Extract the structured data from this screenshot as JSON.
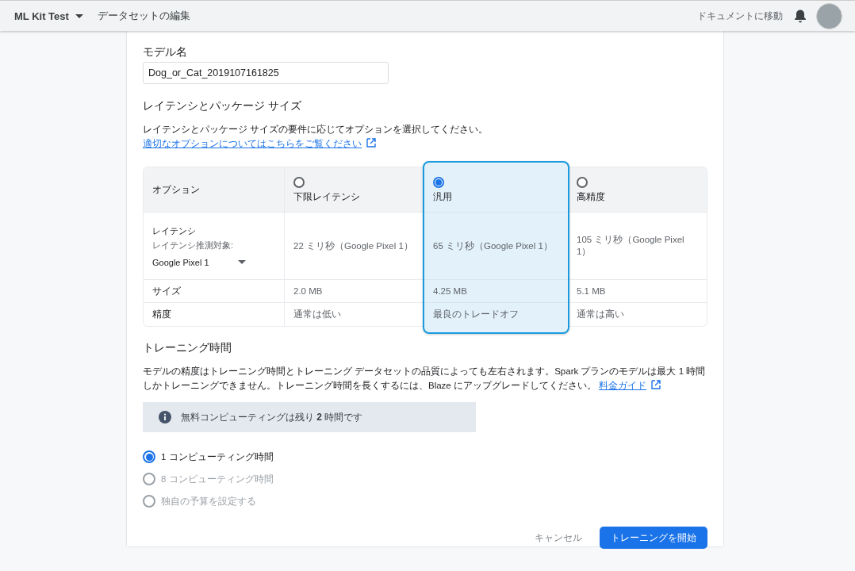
{
  "top_bar": {
    "project": "ML Kit Test",
    "page_title": "データセットの編集",
    "docs_link": "ドキュメントに移動"
  },
  "model_name": {
    "label": "モデル名",
    "value": "Dog_or_Cat_2019107161825"
  },
  "latency_section": {
    "heading": "レイテンシとパッケージ サイズ",
    "description": "レイテンシとパッケージ サイズの要件に応じてオプションを選択してください。",
    "link": "適切なオプションについてはこちらをご覧ください",
    "row_labels": {
      "header": "オプション",
      "latency": "レイテンシ",
      "latency_target_label": "レイテンシ推測対象:",
      "device": "Google Pixel 1",
      "size": "サイズ",
      "accuracy": "精度"
    },
    "options": [
      {
        "name": "下限レイテンシ",
        "selected": false,
        "latency": "22 ミリ秒（Google Pixel 1）",
        "size": "2.0 MB",
        "accuracy": "通常は低い"
      },
      {
        "name": "汎用",
        "selected": true,
        "latency": "65 ミリ秒（Google Pixel 1）",
        "size": "4.25 MB",
        "accuracy": "最良のトレードオフ"
      },
      {
        "name": "高精度",
        "selected": false,
        "latency": "105 ミリ秒（Google Pixel 1）",
        "size": "5.1 MB",
        "accuracy": "通常は高い"
      }
    ]
  },
  "training_section": {
    "heading": "トレーニング時間",
    "description": "モデルの精度はトレーニング時間とトレーニング データセットの品質によっても左右されます。Spark プランのモデルは最大 1 時間しかトレーニングできません。トレーニング時間を長くするには、Blaze にアップグレードしてください。",
    "link": "料金ガイド",
    "notice": "無料コンピューティングは残り **2** 時間です",
    "choices": [
      {
        "label": "1 コンピューティング時間",
        "selected": true,
        "disabled": false
      },
      {
        "label": "8 コンピューティング時間",
        "selected": false,
        "disabled": true
      },
      {
        "label": "独自の予算を設定する",
        "selected": false,
        "disabled": true
      }
    ]
  },
  "buttons": {
    "cancel": "キャンセル",
    "start": "トレーニングを開始"
  }
}
